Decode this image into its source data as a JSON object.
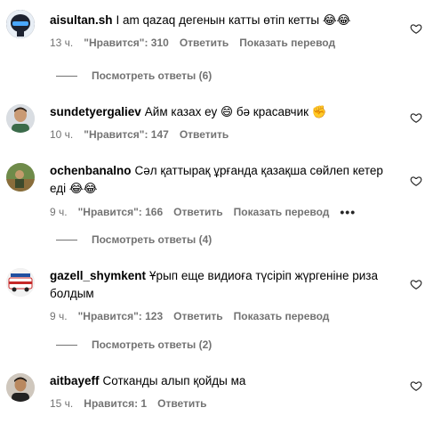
{
  "comments": [
    {
      "username": "aisultan.sh",
      "text": "I am qazaq дегенын катты өтіп кетты 😂😂",
      "time": "13 ч.",
      "likes": "\"Нравится\": 310",
      "reply": "Ответить",
      "translate": "Показать перевод",
      "view_replies": "Посмотреть ответы (6)",
      "more": "",
      "avatar_icon": "helmet-avatar"
    },
    {
      "username": "sundetyergaliev",
      "text": "Айм казах еу 😄 бә красавчик ✊",
      "time": "10 ч.",
      "likes": "\"Нравится\": 147",
      "reply": "Ответить",
      "translate": "",
      "view_replies": "",
      "more": "",
      "avatar_icon": "man-avatar"
    },
    {
      "username": "ochenbanalno",
      "text_line1": "Сәл қаттырақ ұрғанда қазақша сөйлеп кетер",
      "text_line2": "еді 😂😂",
      "time": "9 ч.",
      "likes": "\"Нравится\": 166",
      "reply": "Ответить",
      "translate": "Показать перевод",
      "view_replies": "Посмотреть ответы (4)",
      "more": "•••",
      "avatar_icon": "outdoor-avatar"
    },
    {
      "username": "gazell_shymkent",
      "text_line1": "Ұрып еще видиоға түсіріп жүргеніне риза",
      "text_line2": "болдым",
      "time": "9 ч.",
      "likes": "\"Нравится\": 123",
      "reply": "Ответить",
      "translate": "Показать перевод",
      "view_replies": "Посмотреть ответы (2)",
      "more": "",
      "avatar_icon": "van-avatar"
    },
    {
      "username": "aitbayeff",
      "text": "Сотканды алып қойды ма",
      "time": "15 ч.",
      "likes": "Нравится: 1",
      "reply": "Ответить",
      "translate": "",
      "view_replies": "",
      "more": "",
      "avatar_icon": "man-avatar"
    }
  ],
  "colors": {
    "meta": "#737373",
    "text": "#000000"
  }
}
